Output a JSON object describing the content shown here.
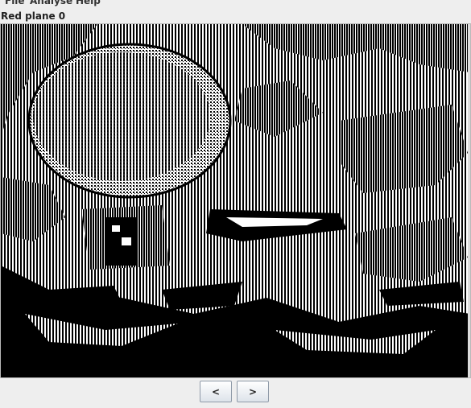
{
  "menu": {
    "items": [
      {
        "label": "File"
      },
      {
        "label": "Analyse"
      },
      {
        "label": "Help"
      }
    ]
  },
  "panel": {
    "title": "Red plane 0"
  },
  "image": {
    "description_icon": "bit-plane-image"
  },
  "nav": {
    "prev_label": "<",
    "next_label": ">"
  }
}
